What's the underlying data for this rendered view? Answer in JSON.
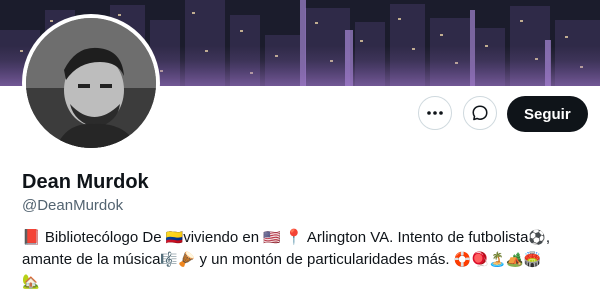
{
  "profile": {
    "name": "Dean Murdok",
    "handle": "@DeanMurdok",
    "bio": {
      "line1_parts": [
        "📕 Bibliotecólogo De ",
        "🇨🇴",
        "viviendo en ",
        "🇺🇸",
        " 📍 Arlington VA.  Intento de futbolista",
        "⚽",
        ","
      ],
      "line2_parts": [
        "amante de la música",
        "🎼🪘",
        " y un montón de particularidades más. ",
        "🛟🪀🏝️🏕️🏟️"
      ],
      "line3_parts": [
        "🏡"
      ]
    }
  },
  "actions": {
    "more_icon": "more-horizontal-icon",
    "message_icon": "message-bubble-icon",
    "follow_label": "Seguir"
  },
  "colors": {
    "follow_bg": "#0f1419",
    "handle": "#536471",
    "border": "#cfd9de"
  }
}
